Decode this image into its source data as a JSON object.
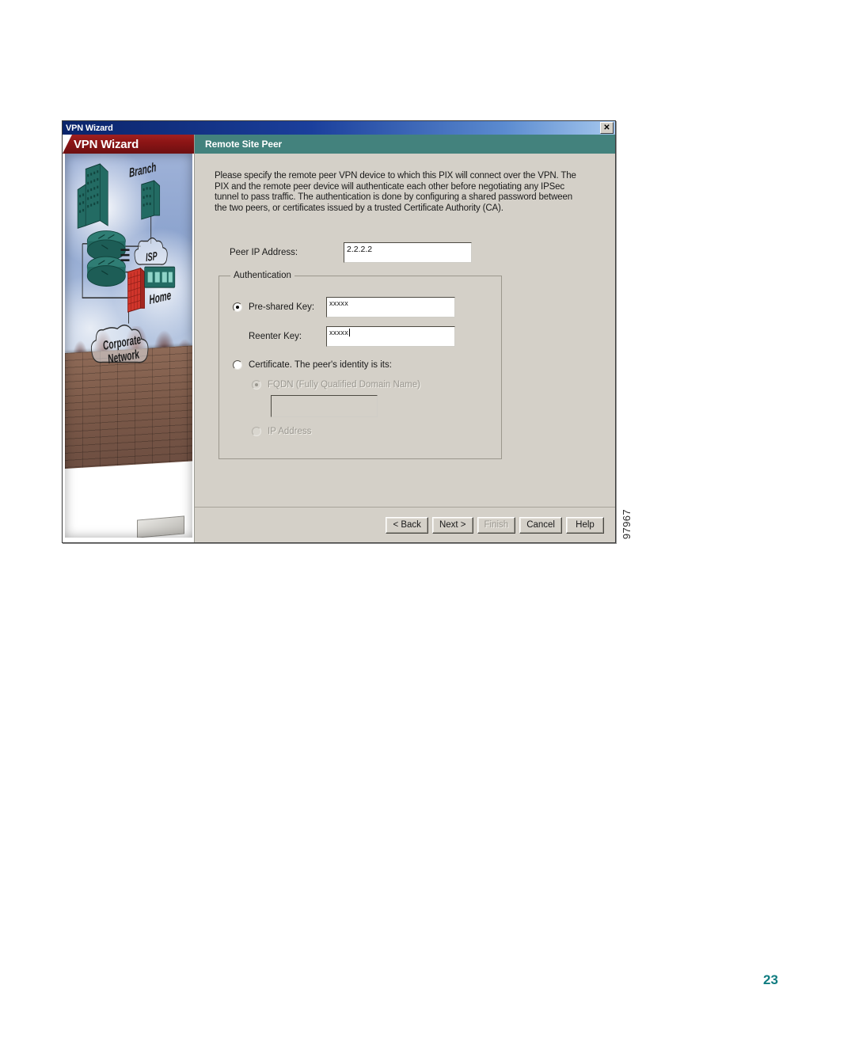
{
  "window": {
    "title": "VPN Wizard",
    "close_icon": "close-icon",
    "close_label": "✕"
  },
  "sidebar": {
    "banner_title": "VPN Wizard",
    "illustration": {
      "name": "vpn-network-illustration",
      "labels": [
        "Branch",
        "ISP",
        "Home",
        "Corporate Network"
      ]
    }
  },
  "page": {
    "header": "Remote Site Peer",
    "intro": "Please specify the remote peer VPN device to which this PIX will connect over the VPN. The PIX and the remote peer device will authenticate each other before negotiating any IPSec tunnel to pass traffic. The authentication is done by configuring a shared password between the two peers, or certificates issued by a trusted Certificate Authority (CA).",
    "peer_ip": {
      "label": "Peer IP Address:",
      "value": "2.2.2.2"
    },
    "authentication": {
      "group_title": "Authentication",
      "preshared": {
        "label": "Pre-shared Key:",
        "selected": true,
        "value": "xxxxx"
      },
      "reenter": {
        "label": "Reenter Key:",
        "value": "xxxxx"
      },
      "certificate": {
        "label": "Certificate. The peer's identity is its:",
        "selected": false,
        "fqdn": {
          "label": "FQDN (Fully Qualified Domain Name)",
          "selected": true,
          "disabled": true,
          "value": ""
        },
        "ip_address": {
          "label": "IP Address",
          "selected": false,
          "disabled": true
        }
      }
    }
  },
  "buttons": [
    {
      "label": "< Back",
      "disabled": false
    },
    {
      "label": "Next >",
      "disabled": false
    },
    {
      "label": "Finish",
      "disabled": true
    },
    {
      "label": "Cancel",
      "disabled": false
    },
    {
      "label": "Help",
      "disabled": false
    }
  ],
  "figure_id": "97967",
  "page_number": "23",
  "colors": {
    "titlebar_start": "#0a246a",
    "titlebar_end": "#a6c8ee",
    "sidebar_banner": "#8c1515",
    "page_header": "#43827d",
    "dialog_face": "#d4d0c8",
    "page_number": "#0f7c80"
  }
}
